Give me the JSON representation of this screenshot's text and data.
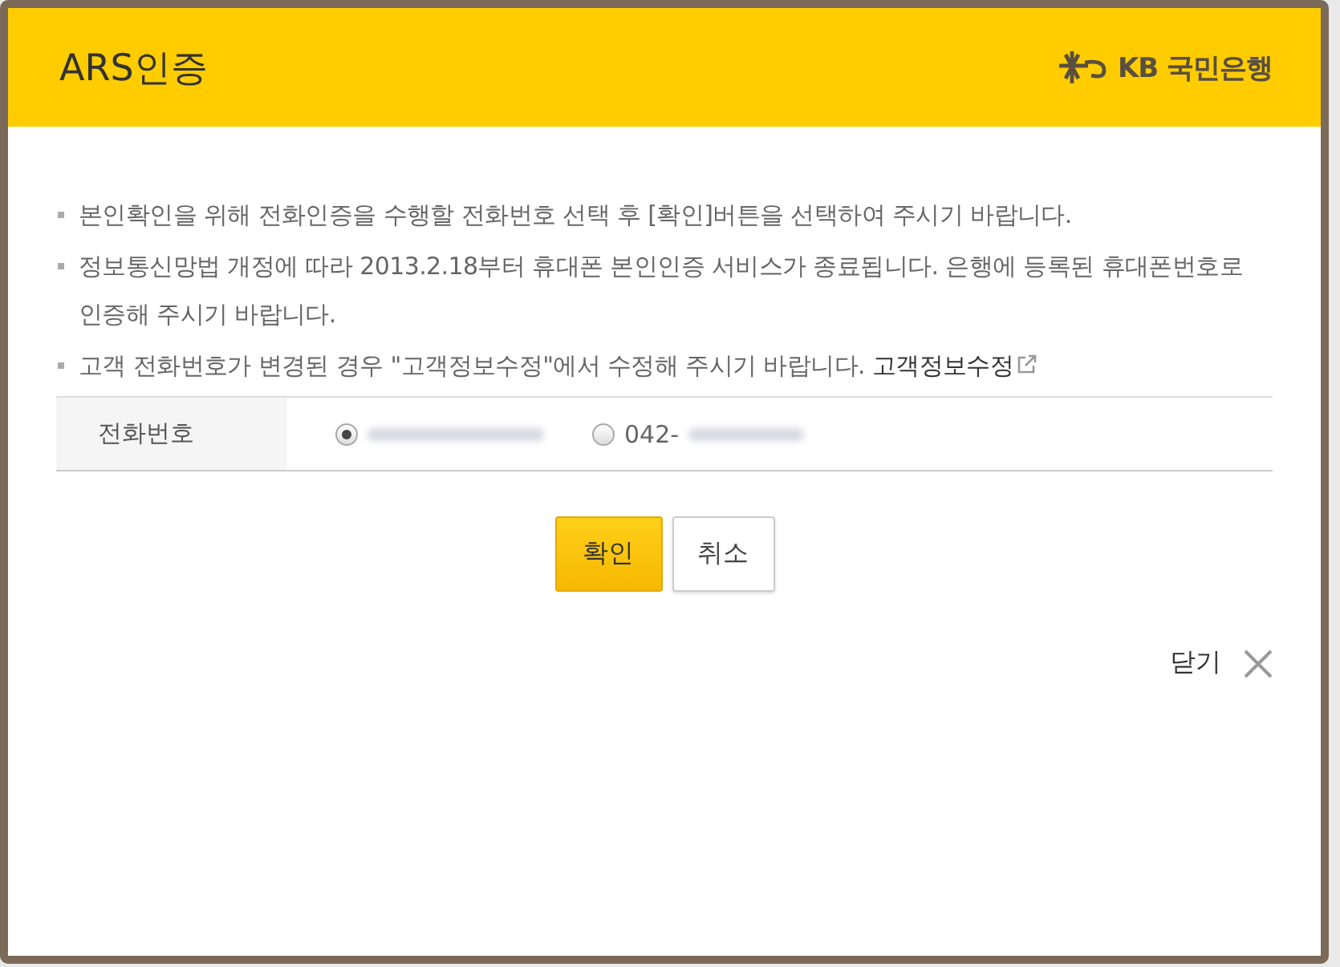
{
  "window": {
    "title": "ARS인증",
    "brand": "KB 국민은행"
  },
  "notices": [
    {
      "text": "본인확인을 위해 전화인증을 수행할 전화번호 선택 후 [확인]버튼을 선택하여 주시기 바랍니다."
    },
    {
      "text": "정보통신망법 개정에 따라 2013.2.18부터 휴대폰 본인인증 서비스가 종료됩니다. 은행에 등록된 휴대폰번호로 인증해 주시기 바랍니다."
    },
    {
      "text": "고객 전화번호가 변경된 경우 \"고객정보수정\"에서 수정해 주시기 바랍니다.",
      "link": "고객정보수정"
    }
  ],
  "phone": {
    "label": "전화번호",
    "options": [
      {
        "selected": true
      },
      {
        "selected": false,
        "label": "042-"
      }
    ]
  },
  "buttons": [
    {
      "label": "확인",
      "kind": "primary"
    },
    {
      "label": "취소",
      "kind": "secondary"
    }
  ],
  "close": {
    "label": "닫기"
  }
}
